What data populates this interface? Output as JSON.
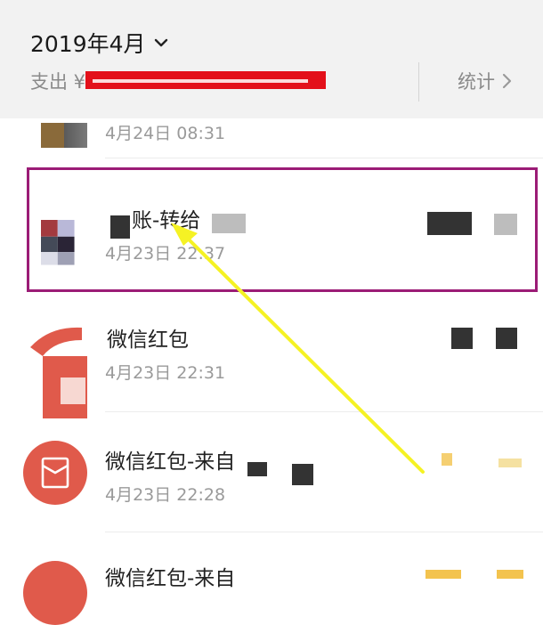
{
  "header": {
    "month": "2019年4月",
    "expense_label": "支出 ¥",
    "stats_label": "统计"
  },
  "transactions": [
    {
      "title": "",
      "time": "4月24日 08:31"
    },
    {
      "title": "账-转给",
      "time": "4月23日 22:37"
    },
    {
      "title": "微信红包",
      "time": "4月23日 22:31"
    },
    {
      "title": "微信红包-来自",
      "time": "4月23日 22:28"
    },
    {
      "title": "微信红包-来自",
      "time": ""
    }
  ],
  "colors": {
    "highlight_border": "#9b1c76",
    "arrow": "#f5f224",
    "redaction": "#e3101a",
    "red_packet": "#e05a4b"
  },
  "icons": [
    "chevron-down-icon",
    "chevron-right-icon",
    "red-packet-icon",
    "arrow-annotation"
  ]
}
